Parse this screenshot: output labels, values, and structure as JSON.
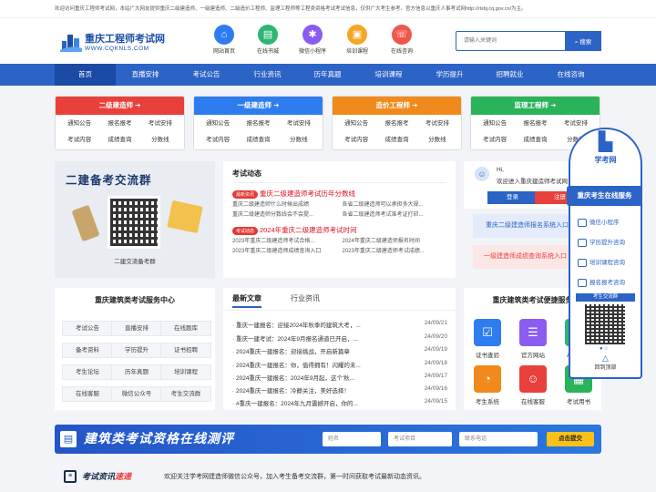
{
  "notice": "欢迎访问重庆工程师考试网，本站广大网友提供重庆二级建造师、一级建造师、二级造价工程师、监理工程师等工程类资格考试考试信息，仅供广大考生参考。官方信息以重庆人事考试网http://rlsbj.cq.gov.cn/为主。",
  "logo": {
    "title": "重庆工程师考试网",
    "url": "WWW.CQKNLS.COM"
  },
  "quick_links": [
    {
      "label": "网站首页",
      "icon": "home-icon",
      "color": "#2e7df0"
    },
    {
      "label": "在线书城",
      "icon": "book-icon",
      "color": "#2bb673"
    },
    {
      "label": "微信小程序",
      "icon": "mini-program-icon",
      "color": "#8a5cf0"
    },
    {
      "label": "培训课程",
      "icon": "course-icon",
      "color": "#f5a623"
    },
    {
      "label": "在线咨询",
      "icon": "chat-icon",
      "color": "#f0564a"
    }
  ],
  "search": {
    "placeholder": "请输入关键词",
    "button": "搜索"
  },
  "nav": [
    "首页",
    "直播安排",
    "考试公告",
    "行业资讯",
    "历年真题",
    "培训课程",
    "学历提升",
    "招聘就业",
    "在线咨询"
  ],
  "categories": [
    {
      "title": "二级建造师",
      "color": "#e8403a",
      "items": [
        "通知公告",
        "报名报考",
        "考试安排",
        "考试内容",
        "成绩查询",
        "分数线"
      ]
    },
    {
      "title": "一级建造师",
      "color": "#2e7df0",
      "items": [
        "通知公告",
        "报名报考",
        "考试安排",
        "考试内容",
        "成绩查询",
        "分数线"
      ]
    },
    {
      "title": "造价工程师",
      "color": "#f08a1c",
      "items": [
        "通知公告",
        "报名报考",
        "考试安排",
        "考试内容",
        "成绩查询",
        "分数线"
      ]
    },
    {
      "title": "监理工程师",
      "color": "#2bb35a",
      "items": [
        "通知公告",
        "报名报考",
        "考试安排",
        "考试内容",
        "成绩查询",
        "分数线"
      ]
    }
  ],
  "promo": {
    "title": "二建备考交流群",
    "caption": "二建交流备考群"
  },
  "exam_news": {
    "title": "考试动态",
    "block1": {
      "tag": "最新资讯",
      "headline": "重庆二级建造师考试历年分数线",
      "items": [
        "重庆二级建造师什么时候出成绩",
        "各省二级建造师可以承担多大规...",
        "重庆二级建造师分数线会不会提...",
        "各省二级建造师考试准考证打印..."
      ]
    },
    "block2": {
      "tag": "考试动态",
      "headline": "2024年重庆二级建造师考试时间",
      "items": [
        "2023年重庆二级建造师考试合格...",
        "2024年重庆二级建造师报名时间",
        "2023年重庆二级建造师成绩查询入口",
        "2023年重庆二级建造师考试成绩..."
      ]
    }
  },
  "user": {
    "greeting": "Hi,",
    "welcome": "欢迎进入重庆建造师考试网",
    "login": "登录",
    "register": "注册"
  },
  "links": [
    "重庆二级建造师报名系统入口",
    "一级建造师成绩查询系统入口"
  ],
  "service_center": {
    "title": "重庆建筑类考试服务中心",
    "items": [
      "考试公告",
      "直播安排",
      "在线题库",
      "备考资料",
      "学历提升",
      "证书招聘",
      "考生论坛",
      "历年真题",
      "培训课程",
      "在线客服",
      "微信公众号",
      "考生交流群"
    ]
  },
  "articles": {
    "tabs": [
      "最新文章",
      "行业资讯"
    ],
    "rows": [
      {
        "title": "· 重庆一建报名：迎接2024年秋季的建筑大考，...",
        "date": "24/09/21"
      },
      {
        "title": "· 重庆一建考试：2024年9月报名通道已开启，...",
        "date": "24/09/20"
      },
      {
        "title": "· 2024重庆一建报名：迎接挑战，开启新篇章",
        "date": "24/09/19"
      },
      {
        "title": "· 2024重庆一建报名：你，值得拥有！闪耀的未...",
        "date": "24/09/18"
      },
      {
        "title": "· 2024重庆一建报名：2024年9月起，这个'秋...",
        "date": "24/09/17"
      },
      {
        "title": "· 2024重庆一建报名：冷静关注，美好选择！",
        "date": "24/09/16"
      },
      {
        "title": "· #重庆一建报名：2024年九月震撼开启，你的...",
        "date": "24/09/15"
      }
    ]
  },
  "convenience": {
    "title": "重庆建筑类考试便捷服务",
    "tiles": [
      {
        "label": "证书查验",
        "color": "#2e7df0",
        "icon": "certificate-icon"
      },
      {
        "label": "官方网站",
        "color": "#8a5cf0",
        "icon": "website-icon"
      },
      {
        "label": "APP下载",
        "color": "#2bb673",
        "icon": "app-icon"
      },
      {
        "label": "考生系统",
        "color": "#f08a1c",
        "icon": "system-icon"
      },
      {
        "label": "在线客服",
        "color": "#e8403a",
        "icon": "service-icon"
      },
      {
        "label": "考试用书",
        "color": "#2bb35a",
        "icon": "book-icon"
      }
    ]
  },
  "float_panel": {
    "brand": "学考网",
    "title": "重庆考生在线服务",
    "items": [
      "微信小程序",
      "学历提升咨询",
      "培训课程咨询",
      "报名报考咨询"
    ],
    "qr_label": "考生交流群",
    "top": "回到顶部"
  },
  "banner": {
    "title": "建筑类考试资格在线测评",
    "name_ph": "姓名",
    "item_ph": "考试项目",
    "phone_ph": "联系电话",
    "submit": "点击提交"
  },
  "footer": {
    "label1": "考试资讯",
    "label2": "速递",
    "text": "欢迎关注学考网建造师微信公众号，加入考生备考交流群，第一时间获取考试最新动态资讯。"
  }
}
